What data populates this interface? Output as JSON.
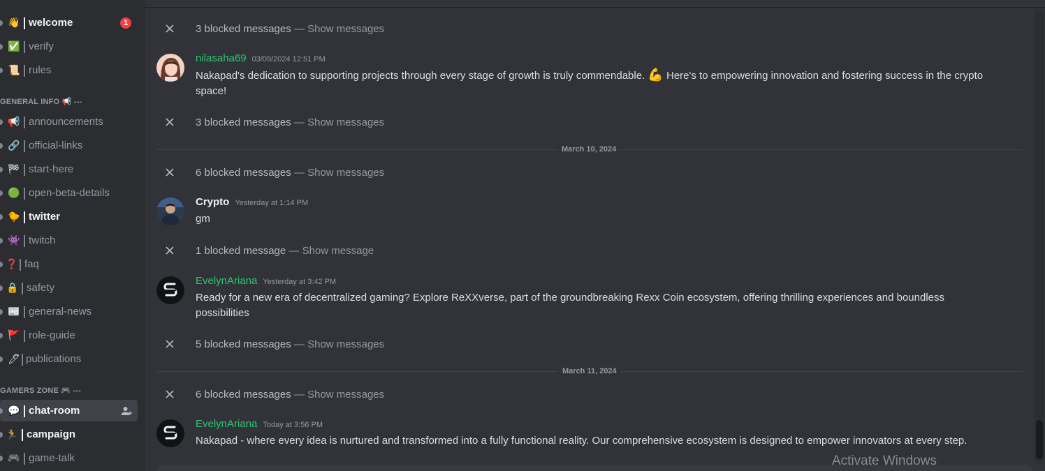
{
  "sidebar": {
    "channels_top": [
      {
        "emoji": "👋",
        "label": "welcome",
        "bold": true,
        "badge": "1"
      },
      {
        "emoji": "✅",
        "label": "verify",
        "bold": false
      },
      {
        "emoji": "📜",
        "label": "rules",
        "bold": false
      }
    ],
    "category_general": "GENERAL INFO 📢 ---",
    "channels_general": [
      {
        "emoji": "📢",
        "label": "announcements",
        "bold": false
      },
      {
        "emoji": "🔗",
        "label": "official-links",
        "bold": false
      },
      {
        "emoji": "🏁",
        "label": "start-here",
        "bold": false
      },
      {
        "emoji": "🟢",
        "label": "open-beta-details",
        "bold": false
      },
      {
        "emoji": "🐤",
        "label": "twitter",
        "bold": true
      },
      {
        "emoji": "👾",
        "label": "twitch",
        "bold": false
      },
      {
        "emoji": "❓",
        "label": "faq",
        "bold": false
      },
      {
        "emoji": "🔒",
        "label": "safety",
        "bold": false
      },
      {
        "emoji": "📰",
        "label": "general-news",
        "bold": false
      },
      {
        "emoji": "🚩",
        "label": "role-guide",
        "bold": false
      },
      {
        "emoji": "🖊",
        "label": "publications",
        "bold": false
      }
    ],
    "category_gamers": "GAMERS ZONE 🎮 ---",
    "channels_gamers": [
      {
        "emoji": "💬",
        "label": "chat-room",
        "bold": true,
        "active": true
      },
      {
        "emoji": "🏃",
        "label": "campaign",
        "bold": true
      },
      {
        "emoji": "🎮",
        "label": "game-talk",
        "bold": false
      }
    ]
  },
  "chat": {
    "blocked": [
      {
        "count_text": "3 blocked messages",
        "sep": " — ",
        "action": "Show messages"
      },
      {
        "count_text": "3 blocked messages",
        "sep": " — ",
        "action": "Show messages"
      },
      {
        "count_text": "6 blocked messages",
        "sep": " — ",
        "action": "Show messages"
      },
      {
        "count_text": "1 blocked message",
        "sep": " — ",
        "action": "Show message"
      },
      {
        "count_text": "5 blocked messages",
        "sep": " — ",
        "action": "Show messages"
      },
      {
        "count_text": "6 blocked messages",
        "sep": " — ",
        "action": "Show messages"
      }
    ],
    "messages": [
      {
        "author": "nilasaha69",
        "timestamp": "03/09/2024 12:51 PM",
        "text_a": "Nakapad's dedication to supporting projects through every stage of growth is truly commendable.",
        "emoji": "💪",
        "text_b": "Here's to empowering innovation and fostering success in the crypto space!"
      },
      {
        "author": "Crypto",
        "timestamp": "Yesterday at 1:14 PM",
        "text": "gm"
      },
      {
        "author": "EvelynAriana",
        "timestamp": "Yesterday at 3:42 PM",
        "text": "Ready for a new era of decentralized gaming? Explore ReXXverse, part of the groundbreaking Rexx Coin ecosystem, offering thrilling experiences and boundless possibilities"
      },
      {
        "author": "EvelynAriana",
        "timestamp": "Today at 3:56 PM",
        "text": "Nakapad - where every idea is nurtured and transformed into a fully functional reality. Our comprehensive ecosystem is designed to empower innovators at every step."
      }
    ],
    "dividers": [
      "March 10, 2024",
      "March 11, 2024"
    ]
  },
  "watermark": "Activate Windows",
  "colors": {
    "sidebar_bg": "#2b2d31",
    "chat_bg": "#313338",
    "username_green": "#2dc770",
    "badge_red": "#f23f43"
  }
}
